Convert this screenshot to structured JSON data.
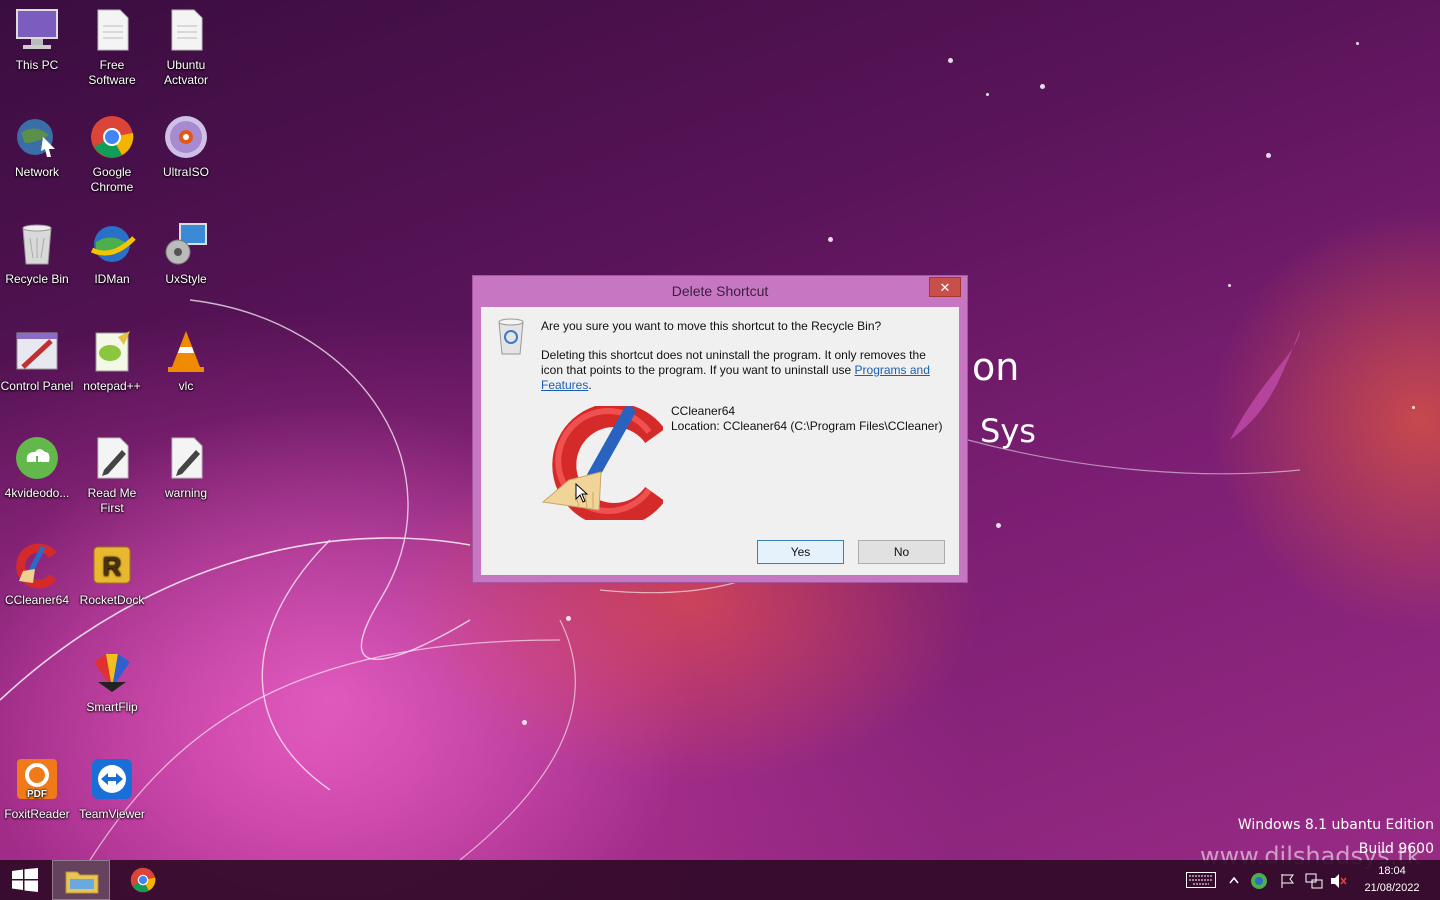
{
  "desktop": {
    "icons": [
      {
        "label": "This PC",
        "icon": "computer-icon"
      },
      {
        "label": "Free Software",
        "icon": "text-file-icon"
      },
      {
        "label": "Ubuntu Actvator",
        "icon": "text-file-icon"
      },
      {
        "label": "Network",
        "icon": "network-globe-icon"
      },
      {
        "label": "Google Chrome",
        "icon": "chrome-icon"
      },
      {
        "label": "UltraISO",
        "icon": "disc-icon"
      },
      {
        "label": "Recycle Bin",
        "icon": "recycle-bin-icon"
      },
      {
        "label": "IDMan",
        "icon": "idm-globe-icon"
      },
      {
        "label": "UxStyle",
        "icon": "uxstyle-icon"
      },
      {
        "label": "Control Panel",
        "icon": "control-panel-icon"
      },
      {
        "label": "notepad++",
        "icon": "notepad-plus-icon"
      },
      {
        "label": "vlc",
        "icon": "vlc-cone-icon"
      },
      {
        "label": "4kvideodo...",
        "icon": "download-cloud-icon"
      },
      {
        "label": "Read Me First",
        "icon": "text-edit-icon"
      },
      {
        "label": "warning",
        "icon": "text-edit-icon"
      },
      {
        "label": "CCleaner64",
        "icon": "ccleaner-icon"
      },
      {
        "label": "RocketDock",
        "icon": "rocketdock-icon"
      },
      {
        "label": "SmartFlip",
        "icon": "smartflip-icon"
      },
      {
        "label": "FoxitReader",
        "icon": "pdf-icon"
      },
      {
        "label": "TeamViewer",
        "icon": "teamviewer-icon"
      }
    ],
    "wallpaper_text": {
      "line1": "on",
      "line2": "Sys"
    },
    "watermark": {
      "edition": "Windows 8.1 ubantu Edition",
      "build": "Build 9600",
      "site": "www.dilshadsys.tk"
    }
  },
  "dialog": {
    "title": "Delete Shortcut",
    "close_label": "✕",
    "question": "Are you sure you want to move this shortcut to the Recycle Bin?",
    "details_text": "Deleting this shortcut does not uninstall the program. It only removes the icon that points to the program. If you want to uninstall use ",
    "link_text": "Programs and Features",
    "details_end": ".",
    "target_name": "CCleaner64",
    "target_location": "Location: CCleaner64 (C:\\Program Files\\CCleaner)",
    "yes_label": "Yes",
    "no_label": "No"
  },
  "taskbar": {
    "items": [
      "start-button",
      "file-explorer",
      "google-chrome"
    ],
    "tray": {
      "time": "18:04",
      "date": "21/08/2022"
    }
  },
  "colors": {
    "dialog_frame": "#c777c1",
    "close_button": "#c7504a",
    "link": "#1a5fb4"
  }
}
